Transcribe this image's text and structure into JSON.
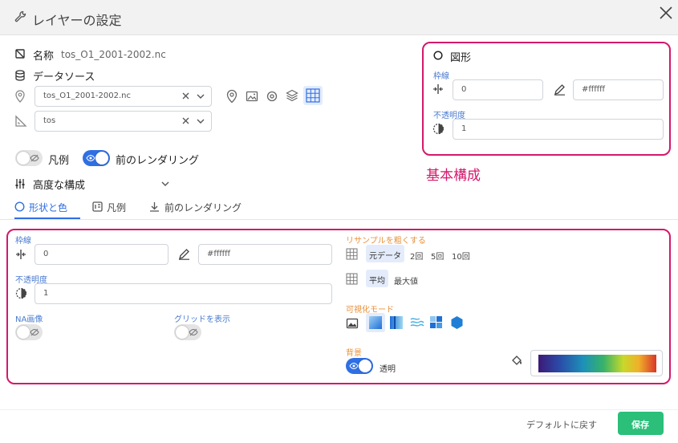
{
  "dialog": {
    "title": "レイヤーの設定",
    "close_icon": "close-icon",
    "title_icon": "wrench-icon"
  },
  "layer": {
    "name_label": "名称",
    "name_value": "tos_O1_2001-2002.nc",
    "datasource_label": "データソース",
    "source_select": "tos_O1_2001-2002.nc",
    "variable_select": "tos"
  },
  "toggles": {
    "legend_label": "凡例",
    "legend_on": false,
    "prev_render_label": "前のレンダリング",
    "prev_render_on": true
  },
  "advanced": {
    "label": "高度な構成"
  },
  "tabs": [
    {
      "label": "形状と色",
      "active": true
    },
    {
      "label": "凡例",
      "active": false
    },
    {
      "label": "前のレンダリング",
      "active": false
    }
  ],
  "shape_panel": {
    "header": "図形",
    "stroke_caption": "枠線",
    "stroke_width": "0",
    "stroke_color": "#ffffff",
    "opacity_caption": "不透明度",
    "opacity_value": "1"
  },
  "annotation": {
    "basic_config": "基本構成",
    "color": "#d4186c"
  },
  "style_panel": {
    "stroke_caption": "枠線",
    "stroke_width": "0",
    "stroke_color": "#ffffff",
    "opacity_caption": "不透明度",
    "opacity_value": "1",
    "na_image_caption": "NA画像",
    "na_image_on": false,
    "grid_caption": "グリッドを表示",
    "grid_on": false,
    "resample_caption": "リサンプルを粗くする",
    "resample_options": [
      "元データ",
      "2回",
      "5回",
      "10回"
    ],
    "resample_selected": "元データ",
    "agg_options": [
      "平均",
      "最大値"
    ],
    "agg_selected": "平均",
    "viz_mode_caption": "可視化モード",
    "viz_modes": [
      "image-mode-icon",
      "gradient-square-icon",
      "gradient-bar-icon",
      "contour-icon",
      "pixel-blocks-icon",
      "hexagon-icon"
    ],
    "viz_selected": 1,
    "background_caption": "背景",
    "transparent_label": "透明",
    "transparent_on": true,
    "colormap_colors": [
      "#3d1a78",
      "#2a4ba8",
      "#1d91b8",
      "#36b26a",
      "#c8d82a",
      "#f0b02a",
      "#d8362a"
    ]
  },
  "footer": {
    "reset_label": "デフォルトに戻す",
    "save_label": "保存",
    "save_color": "#2bbf7a"
  },
  "colors": {
    "accent": "#2f6fe4",
    "caption_blue": "#4a7bd0",
    "caption_orange": "#e8903a"
  }
}
